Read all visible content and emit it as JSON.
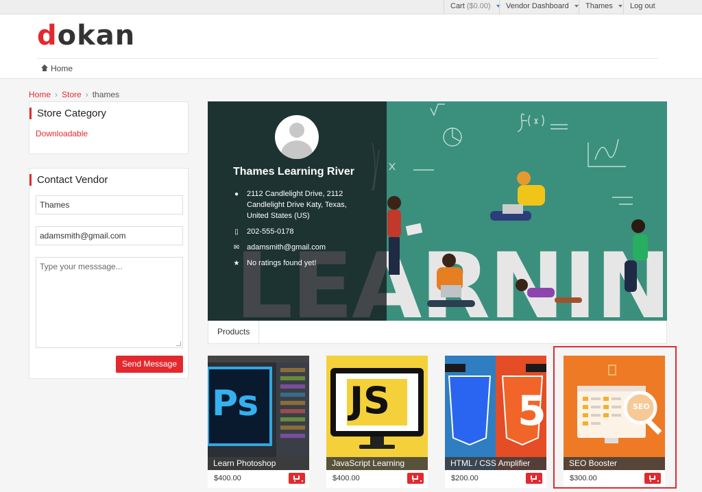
{
  "topbar": {
    "cart_label": "Cart",
    "cart_total": "($0.00)",
    "vendor_dashboard": "Vendor Dashboard",
    "user_menu": "Thames",
    "logout": "Log out"
  },
  "header": {
    "logo_first": "d",
    "logo_rest": "okan",
    "home": "Home"
  },
  "breadcrumb": {
    "home": "Home",
    "store": "Store",
    "current": "thames",
    "separator": "›"
  },
  "sidebar": {
    "category_title": "Store Category",
    "category_link": "Downloadable",
    "contact_title": "Contact Vendor",
    "name_value": "Thames",
    "email_value": "adamsmith@gmail.com",
    "message_placeholder": "Type your messsage...",
    "send_label": "Send Message"
  },
  "store": {
    "name": "Thames Learning River",
    "address": "2112 Candlelight Drive, 2112 Candlelight Drive Katy, Texas, United States (US)",
    "phone": "202-555-0178",
    "email": "adamsmith@gmail.com",
    "rating": "No ratings found yet!",
    "banner_word": "LEARNING"
  },
  "tabs": [
    "Products"
  ],
  "products": [
    {
      "name": "Learn Photoshop",
      "price": "$400.00",
      "thumb_text": "Ps"
    },
    {
      "name": "JavaScript Learning",
      "price": "$400.00",
      "thumb_text": "JS"
    },
    {
      "name": "HTML / CSS Amplifier",
      "price": "$200.00",
      "thumb_text": "5"
    },
    {
      "name": "SEO Booster",
      "price": "$300.00",
      "thumb_text": "SEO"
    }
  ],
  "colors": {
    "accent": "#e3292e",
    "banner_teal": "#3a8a7a"
  }
}
